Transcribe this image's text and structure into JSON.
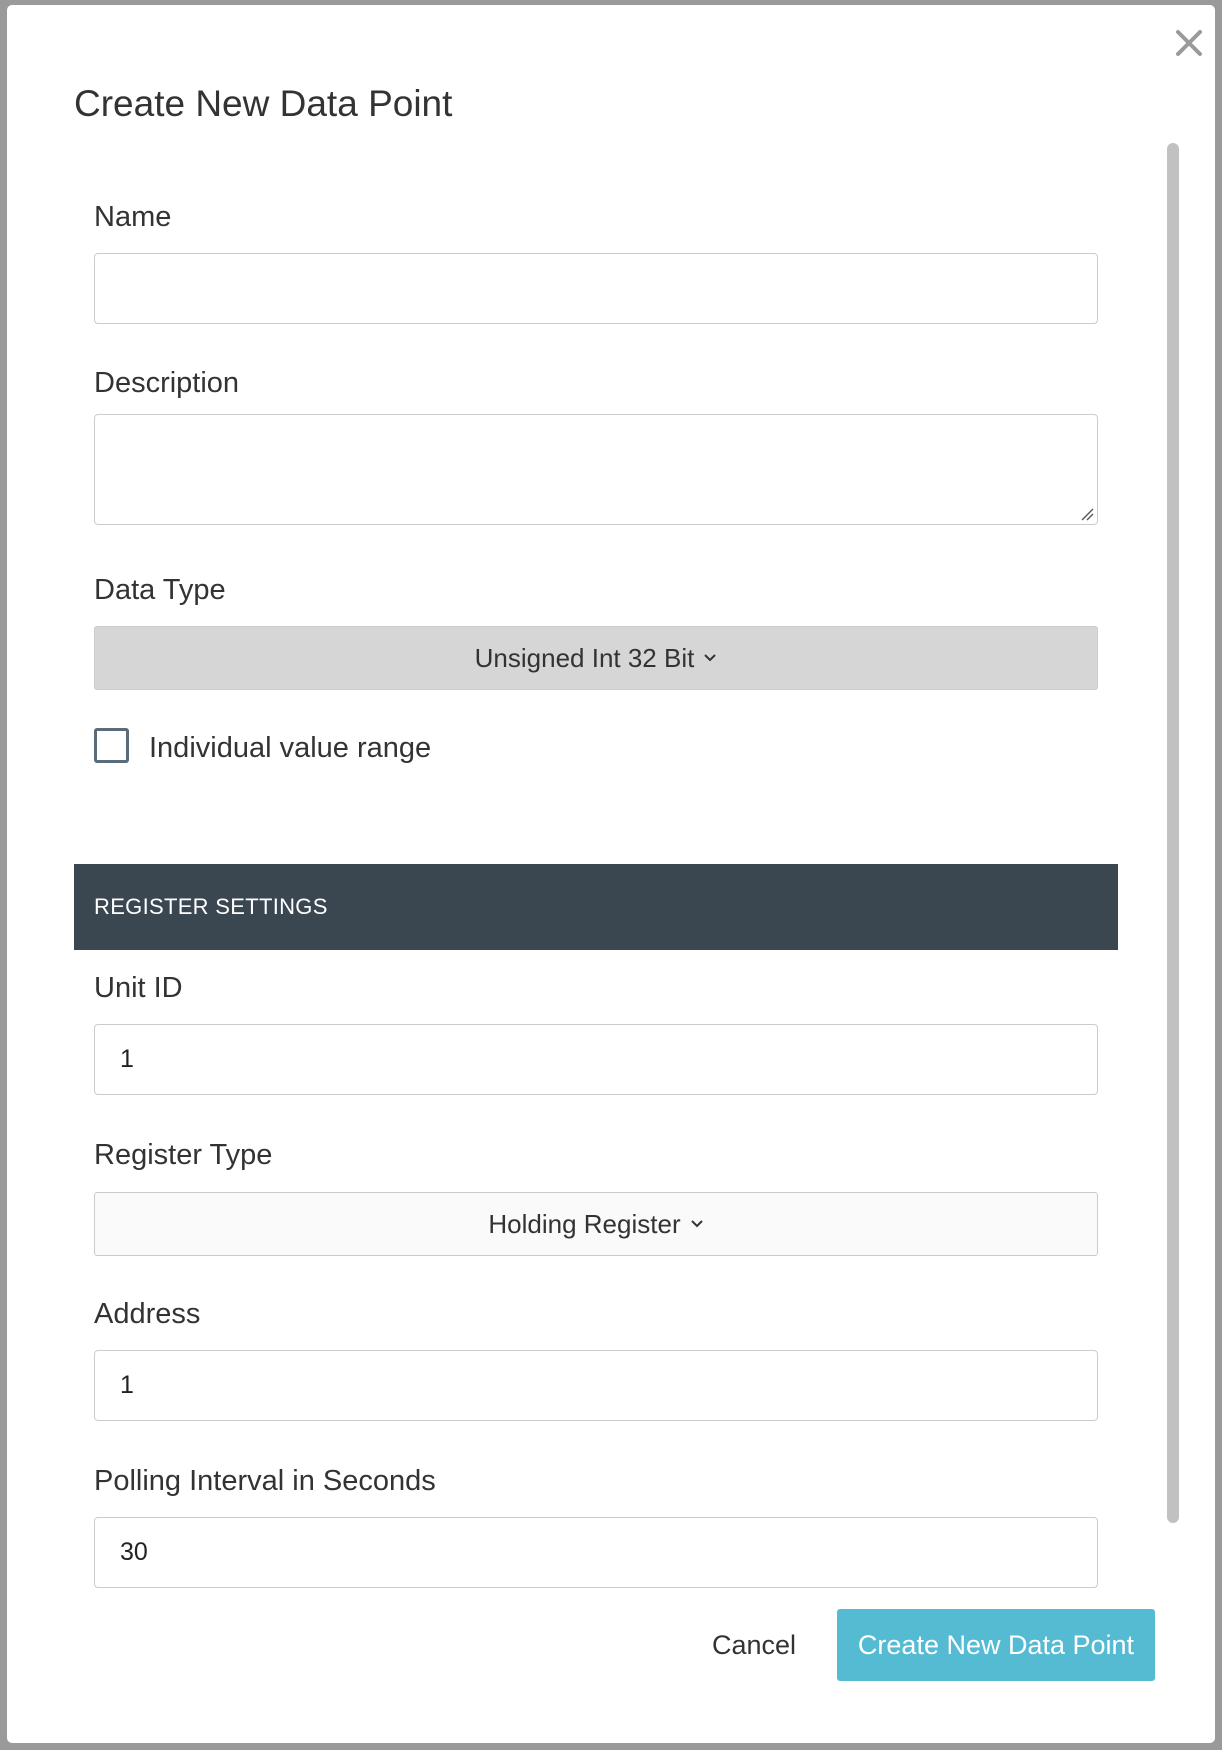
{
  "dialog": {
    "title": "Create New Data Point",
    "close_icon": "close-icon"
  },
  "form": {
    "name": {
      "label": "Name",
      "value": ""
    },
    "description": {
      "label": "Description",
      "value": ""
    },
    "data_type": {
      "label": "Data Type",
      "selected": "Unsigned Int 32 Bit"
    },
    "individual_range": {
      "label": "Individual value range",
      "checked": false
    },
    "register_section": {
      "title": "REGISTER SETTINGS"
    },
    "unit_id": {
      "label": "Unit ID",
      "value": "1"
    },
    "register_type": {
      "label": "Register Type",
      "selected": "Holding Register"
    },
    "address": {
      "label": "Address",
      "value": "1"
    },
    "polling_interval": {
      "label": "Polling Interval in Seconds",
      "value": "30"
    }
  },
  "footer": {
    "cancel_label": "Cancel",
    "submit_label": "Create New Data Point"
  },
  "colors": {
    "section_bar": "#3a4650",
    "primary_button": "#55bbd3",
    "data_type_select_bg": "#d6d6d6"
  }
}
